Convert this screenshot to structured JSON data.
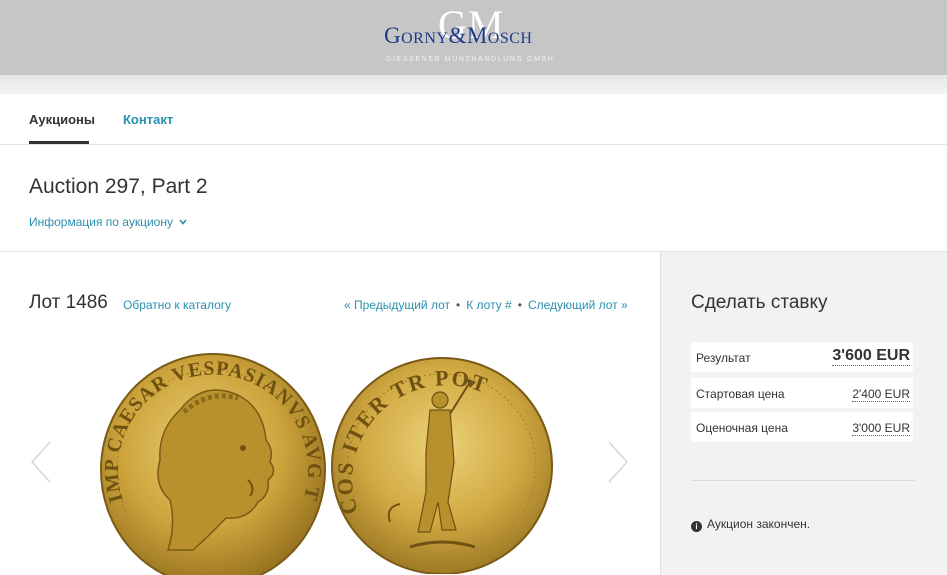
{
  "header": {
    "logo_gm": "GM",
    "logo_name": "Gorny&Mosch",
    "logo_subtitle": "GIESSENER MÜNZHANDLUNG GMBH"
  },
  "nav": {
    "items": [
      {
        "label": "Аукционы"
      },
      {
        "label": "Контакт"
      }
    ]
  },
  "auction": {
    "title": "Auction 297, Part 2",
    "info_label": "Информация по аукциону"
  },
  "lot": {
    "title": "Лот 1486",
    "back_label": "Обратно к каталогу",
    "prev_label": "« Предыдущий лот",
    "goto_label": "К лоту #",
    "next_label": "Следующий лот »",
    "obverse_legend": "IMP CAESAR VESPASIANVS AVG TR P",
    "reverse_legend": "COS ITER TR POT"
  },
  "bid": {
    "title": "Сделать ставку",
    "result_label": "Результат",
    "result_value": "3'600 EUR",
    "start_label": "Стартовая цена",
    "start_value": "2'400 EUR",
    "estimate_label": "Оценочная цена",
    "estimate_value": "3'000 EUR",
    "closed_text": "Аукцион закончен."
  },
  "colors": {
    "link": "#2a8fae",
    "header_bg": "#c6c6c6",
    "logo_blue": "#1e3a8a",
    "coin_gold": "#c9a23a"
  },
  "icons": {
    "info": "info-circle-icon",
    "chevron": "chevron-down-icon",
    "prev_arrow": "chevron-left-icon",
    "next_arrow": "chevron-right-icon"
  }
}
